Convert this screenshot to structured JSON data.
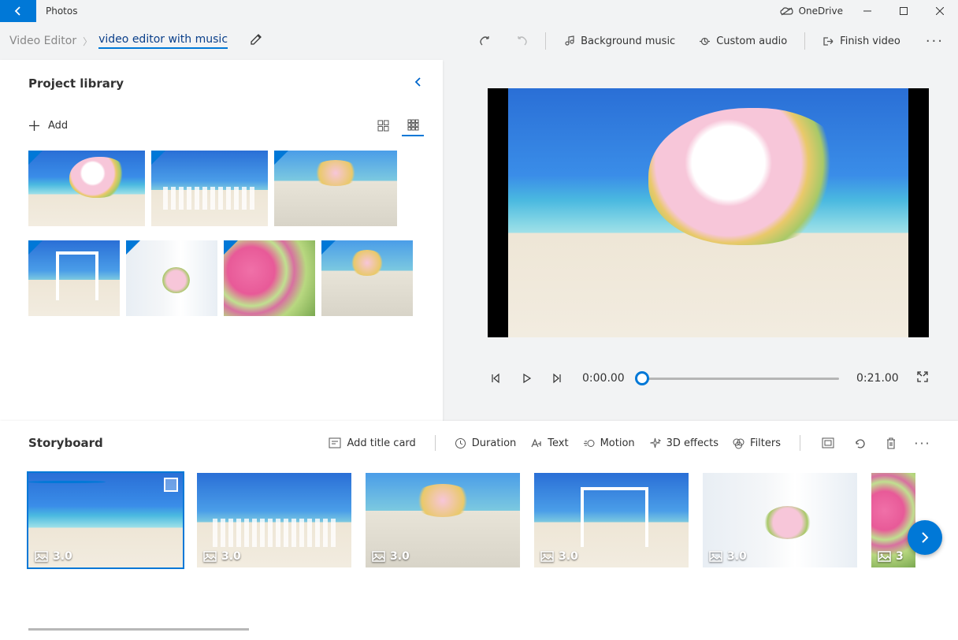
{
  "app_name": "Photos",
  "titlebar": {
    "onedrive_label": "OneDrive"
  },
  "breadcrumb": {
    "root": "Video Editor",
    "current": "video editor with music"
  },
  "actions": {
    "undo": "Undo",
    "redo": "Redo",
    "bg_music": "Background music",
    "custom_audio": "Custom audio",
    "finish": "Finish video"
  },
  "library": {
    "title": "Project library",
    "add": "Add"
  },
  "playback": {
    "current": "0:00.00",
    "total": "0:21.00"
  },
  "storyboard": {
    "title": "Storyboard",
    "tools": {
      "title_card": "Add title card",
      "duration": "Duration",
      "text": "Text",
      "motion": "Motion",
      "effects_3d": "3D effects",
      "filters": "Filters"
    },
    "clips": [
      {
        "duration": "3.0",
        "selected": true
      },
      {
        "duration": "3.0",
        "selected": false
      },
      {
        "duration": "3.0",
        "selected": false
      },
      {
        "duration": "3.0",
        "selected": false
      },
      {
        "duration": "3.0",
        "selected": false
      },
      {
        "duration": "3",
        "selected": false
      }
    ]
  }
}
